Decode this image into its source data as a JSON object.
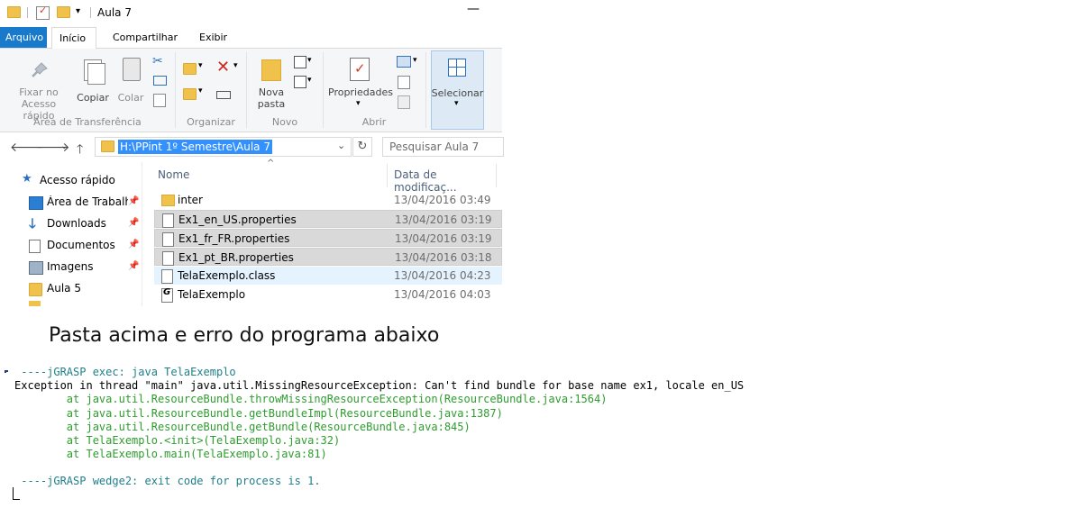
{
  "window": {
    "title": "Aula 7",
    "minimize_glyph": "—"
  },
  "ribbon_tabs": [
    "Arquivo",
    "Início",
    "Compartilhar",
    "Exibir"
  ],
  "ribbon": {
    "clipboard": {
      "pin_label_1": "Fixar no",
      "pin_label_2": "Acesso rápido",
      "copy_label": "Copiar",
      "paste_label": "Colar",
      "group_label": "Área de Transferência"
    },
    "organize": {
      "group_label": "Organizar"
    },
    "new": {
      "new_folder_label_1": "Nova",
      "new_folder_label_2": "pasta",
      "group_label": "Novo"
    },
    "open": {
      "properties_label": "Propriedades",
      "group_label": "Abrir"
    },
    "select": {
      "select_label": "Selecionar"
    }
  },
  "address_bar": {
    "path": "H:\\PPint 1º Semestre\\Aula 7",
    "search_placeholder": "Pesquisar Aula 7"
  },
  "nav_pane": {
    "items": [
      {
        "label": "Acesso rápido",
        "icon": "star-icon"
      },
      {
        "label": "Área de Trabalho",
        "icon": "desktop-icon",
        "pinned": true
      },
      {
        "label": "Downloads",
        "icon": "download-arrow-icon",
        "pinned": true
      },
      {
        "label": "Documentos",
        "icon": "documents-icon",
        "pinned": true
      },
      {
        "label": "Imagens",
        "icon": "pictures-icon",
        "pinned": true
      },
      {
        "label": "Aula 5",
        "icon": "folder-icon"
      }
    ]
  },
  "file_list": {
    "columns": [
      "Nome",
      "Data de modificaç..."
    ],
    "rows": [
      {
        "name": "inter",
        "date": "13/04/2016 03:49",
        "type": "folder",
        "state": "normal"
      },
      {
        "name": "Ex1_en_US.properties",
        "date": "13/04/2016 03:19",
        "type": "file",
        "state": "selected"
      },
      {
        "name": "Ex1_fr_FR.properties",
        "date": "13/04/2016 03:19",
        "type": "file",
        "state": "selected"
      },
      {
        "name": "Ex1_pt_BR.properties",
        "date": "13/04/2016 03:18",
        "type": "file",
        "state": "selected"
      },
      {
        "name": "TelaExemplo.class",
        "date": "13/04/2016 04:23",
        "type": "file",
        "state": "hover"
      },
      {
        "name": "TelaExemplo",
        "date": "13/04/2016 04:03",
        "type": "java",
        "state": "normal"
      }
    ]
  },
  "caption": "Pasta acima e erro do programa abaixo",
  "console": {
    "lines": [
      {
        "text": " ----jGRASP exec: java TelaExemplo",
        "color": "teal"
      },
      {
        "text": "Exception in thread \"main\" java.util.MissingResourceException: Can't find bundle for base name ex1, locale en_US",
        "color": "black"
      },
      {
        "text": "        at java.util.ResourceBundle.throwMissingResourceException(ResourceBundle.java:1564)",
        "color": "green"
      },
      {
        "text": "        at java.util.ResourceBundle.getBundleImpl(ResourceBundle.java:1387)",
        "color": "green"
      },
      {
        "text": "        at java.util.ResourceBundle.getBundle(ResourceBundle.java:845)",
        "color": "green"
      },
      {
        "text": "        at TelaExemplo.<init>(TelaExemplo.java:32)",
        "color": "green"
      },
      {
        "text": "        at TelaExemplo.main(TelaExemplo.java:81)",
        "color": "green"
      },
      {
        "text": "",
        "color": "black"
      },
      {
        "text": " ----jGRASP wedge2: exit code for process is 1.",
        "color": "teal"
      }
    ]
  }
}
